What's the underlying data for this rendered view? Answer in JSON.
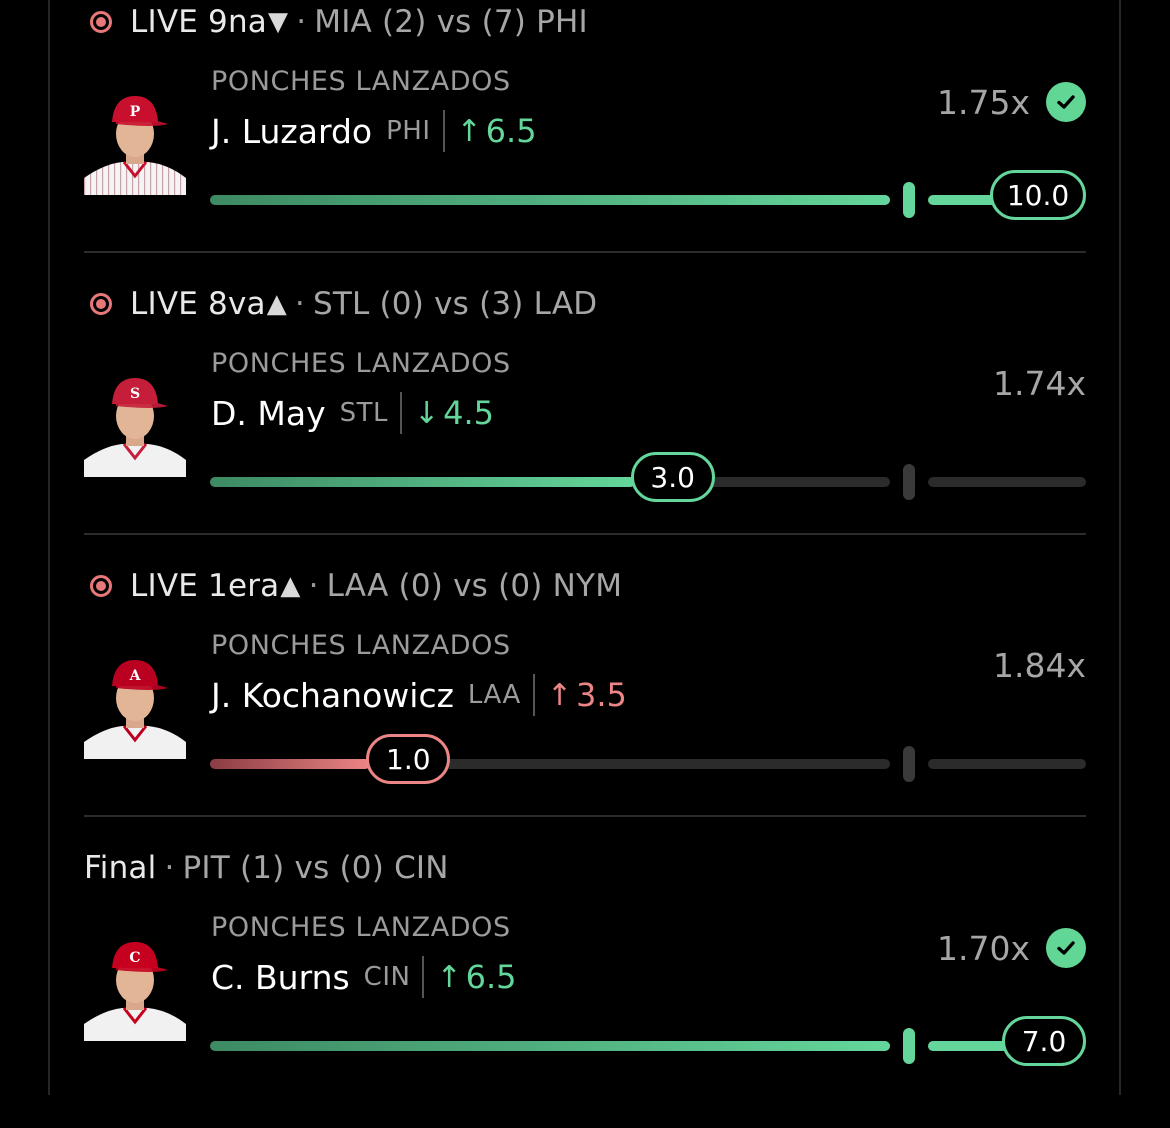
{
  "games": [
    {
      "status": {
        "type": "live",
        "label": "LIVE",
        "inning": "9na",
        "direction": "down",
        "away_team": "MIA",
        "away_score": "(2)",
        "vs": "vs",
        "home_score": "(7)",
        "home_team": "PHI"
      },
      "stat_label": "PONCHES LANZADOS",
      "player": {
        "name": "J. Luzardo",
        "team": "PHI",
        "cap_letter": "P",
        "cap_color": "#c8102e",
        "jersey": "pinstripe"
      },
      "line": {
        "direction": "over",
        "value": "6.5",
        "arrow": "↑",
        "color": "green"
      },
      "multiplier": "1.75x",
      "won": true,
      "progress": {
        "current": "10.0",
        "current_value": 10.0,
        "line_value": 6.5,
        "max_value": 10.0
      }
    },
    {
      "status": {
        "type": "live",
        "label": "LIVE",
        "inning": "8va",
        "direction": "up",
        "away_team": "STL",
        "away_score": "(0)",
        "vs": "vs",
        "home_score": "(3)",
        "home_team": "LAD"
      },
      "stat_label": "PONCHES LANZADOS",
      "player": {
        "name": "D. May",
        "team": "STL",
        "cap_letter": "S",
        "cap_color": "#c41e3a",
        "jersey": "plain"
      },
      "line": {
        "direction": "under",
        "value": "4.5",
        "arrow": "↓",
        "color": "green"
      },
      "multiplier": "1.74x",
      "won": false,
      "progress": {
        "current": "3.0",
        "current_value": 3.0,
        "line_value": 4.5
      }
    },
    {
      "status": {
        "type": "live",
        "label": "LIVE",
        "inning": "1era",
        "direction": "up",
        "away_team": "LAA",
        "away_score": "(0)",
        "vs": "vs",
        "home_score": "(0)",
        "home_team": "NYM"
      },
      "stat_label": "PONCHES LANZADOS",
      "player": {
        "name": "J. Kochanowicz",
        "team": "LAA",
        "cap_letter": "A",
        "cap_color": "#ba0021",
        "jersey": "plain"
      },
      "line": {
        "direction": "over",
        "value": "3.5",
        "arrow": "↑",
        "color": "red"
      },
      "multiplier": "1.84x",
      "won": false,
      "progress": {
        "current": "1.0",
        "current_value": 1.0,
        "line_value": 3.5
      }
    },
    {
      "status": {
        "type": "final",
        "label": "Final",
        "away_team": "PIT",
        "away_score": "(1)",
        "vs": "vs",
        "home_score": "(0)",
        "home_team": "CIN"
      },
      "stat_label": "PONCHES LANZADOS",
      "player": {
        "name": "C. Burns",
        "team": "CIN",
        "cap_letter": "C",
        "cap_color": "#c6011f",
        "jersey": "plain"
      },
      "line": {
        "direction": "over",
        "value": "6.5",
        "arrow": "↑",
        "color": "green"
      },
      "multiplier": "1.70x",
      "won": true,
      "progress": {
        "current": "7.0",
        "current_value": 7.0,
        "line_value": 6.5
      }
    }
  ],
  "colors": {
    "green": "#64d69b",
    "red": "#ec8585",
    "live": "#e8777a"
  },
  "icons": {
    "live": "live-dot-icon",
    "up": "triangle-up-icon",
    "down": "triangle-down-icon",
    "check": "check-circle-icon"
  }
}
